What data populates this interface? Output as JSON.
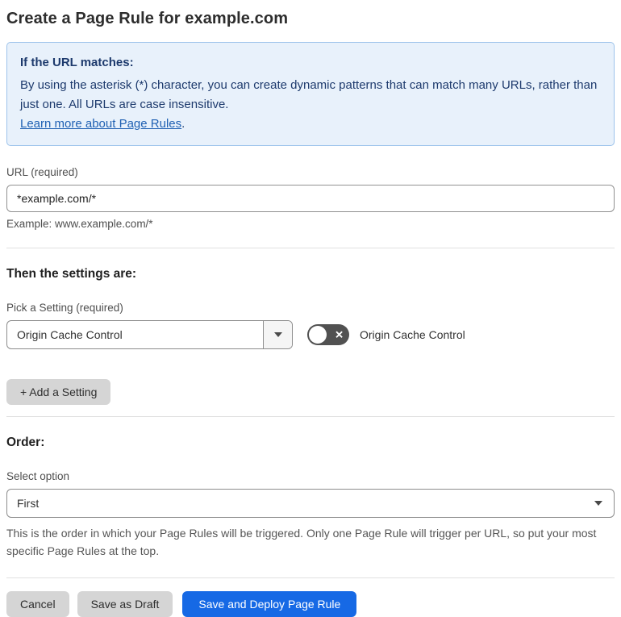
{
  "page": {
    "title": "Create a Page Rule for example.com"
  },
  "info_box": {
    "heading": "If the URL matches:",
    "body": "By using the asterisk (*) character, you can create dynamic patterns that can match many URLs, rather than just one. All URLs are case insensitive.",
    "link": "Learn more about Page Rules",
    "link_suffix": "."
  },
  "url_section": {
    "label": "URL (required)",
    "value": "*example.com/*",
    "example": "Example: www.example.com/*"
  },
  "settings_section": {
    "heading": "Then the settings are:",
    "pick_label": "Pick a Setting (required)",
    "selected_setting": "Origin Cache Control",
    "toggle_label": "Origin Cache Control",
    "toggle_state": "off",
    "toggle_glyph": "✕",
    "add_button": "+ Add a Setting"
  },
  "order_section": {
    "heading": "Order:",
    "label": "Select option",
    "selected_option": "First",
    "help": "This is the order in which your Page Rules will be triggered. Only one Page Rule will trigger per URL, so put your most specific Page Rules at the top."
  },
  "footer": {
    "cancel_label": "Cancel",
    "save_draft_label": "Save as Draft",
    "save_deploy_label": "Save and Deploy Page Rule"
  },
  "colors": {
    "info_bg": "#e8f1fb",
    "info_border": "#9dc3eb",
    "info_text": "#1d3a6d",
    "link_blue": "#2061b3",
    "primary_blue": "#1669e5",
    "toggle_off": "#515151",
    "button_gray": "#d5d5d5"
  }
}
